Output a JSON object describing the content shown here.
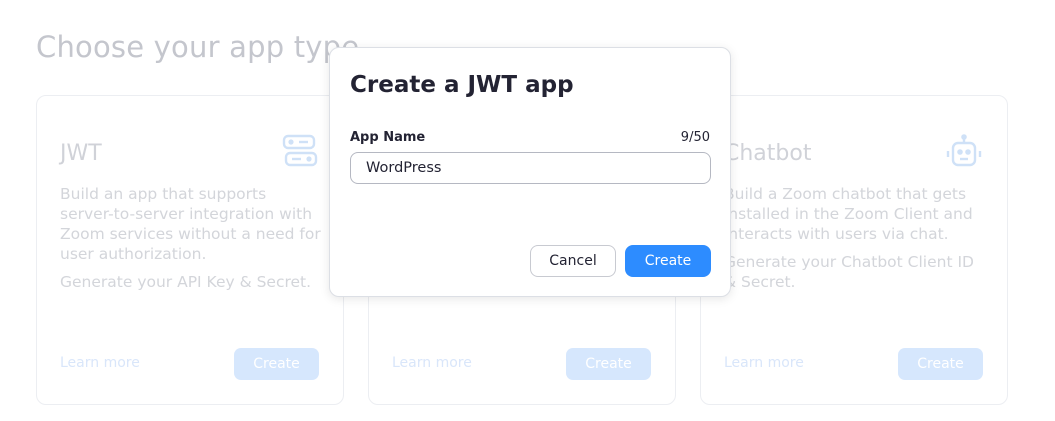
{
  "page_title": "Choose your app type",
  "cards": [
    {
      "title": "JWT",
      "icon": "server-icon",
      "description": [
        "Build an app that supports server-to-server integration with Zoom services without a need for user authorization.",
        "Generate your API Key & Secret."
      ],
      "learn_more": "Learn more",
      "create_label": "Create"
    },
    {
      "title": "",
      "icon": "",
      "description": [
        "",
        ""
      ],
      "learn_more": "Learn more",
      "create_label": "Create"
    },
    {
      "title": "Chatbot",
      "icon": "robot-icon",
      "description": [
        "Build a Zoom chatbot that gets installed in the Zoom Client and interacts with users via chat.",
        "Generate your Chatbot Client ID & Secret."
      ],
      "learn_more": "Learn more",
      "create_label": "Create"
    }
  ],
  "modal": {
    "title": "Create a JWT app",
    "field_label": "App Name",
    "char_count": "9/50",
    "input_value": "WordPress",
    "cancel_label": "Cancel",
    "create_label": "Create"
  },
  "colors": {
    "primary": "#2d8cff",
    "disabled_button": "#d6e7fd",
    "text_dark": "#232333"
  }
}
